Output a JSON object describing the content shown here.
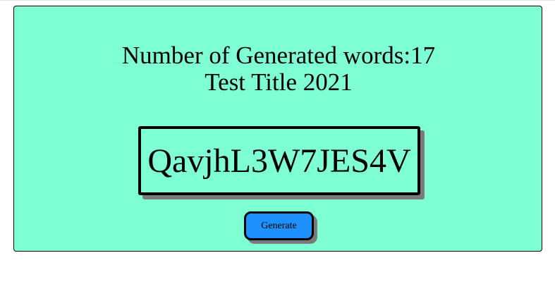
{
  "header": {
    "count_prefix": "Number of Generated words:",
    "count_value": "17",
    "title": "Test Title 2021"
  },
  "generator": {
    "word": "QavjhL3W7JES4V",
    "button_label": "Generate"
  },
  "colors": {
    "card_background": "#7fffd4",
    "button_background": "#1e90ff",
    "shadow": "#7a7a7a"
  }
}
